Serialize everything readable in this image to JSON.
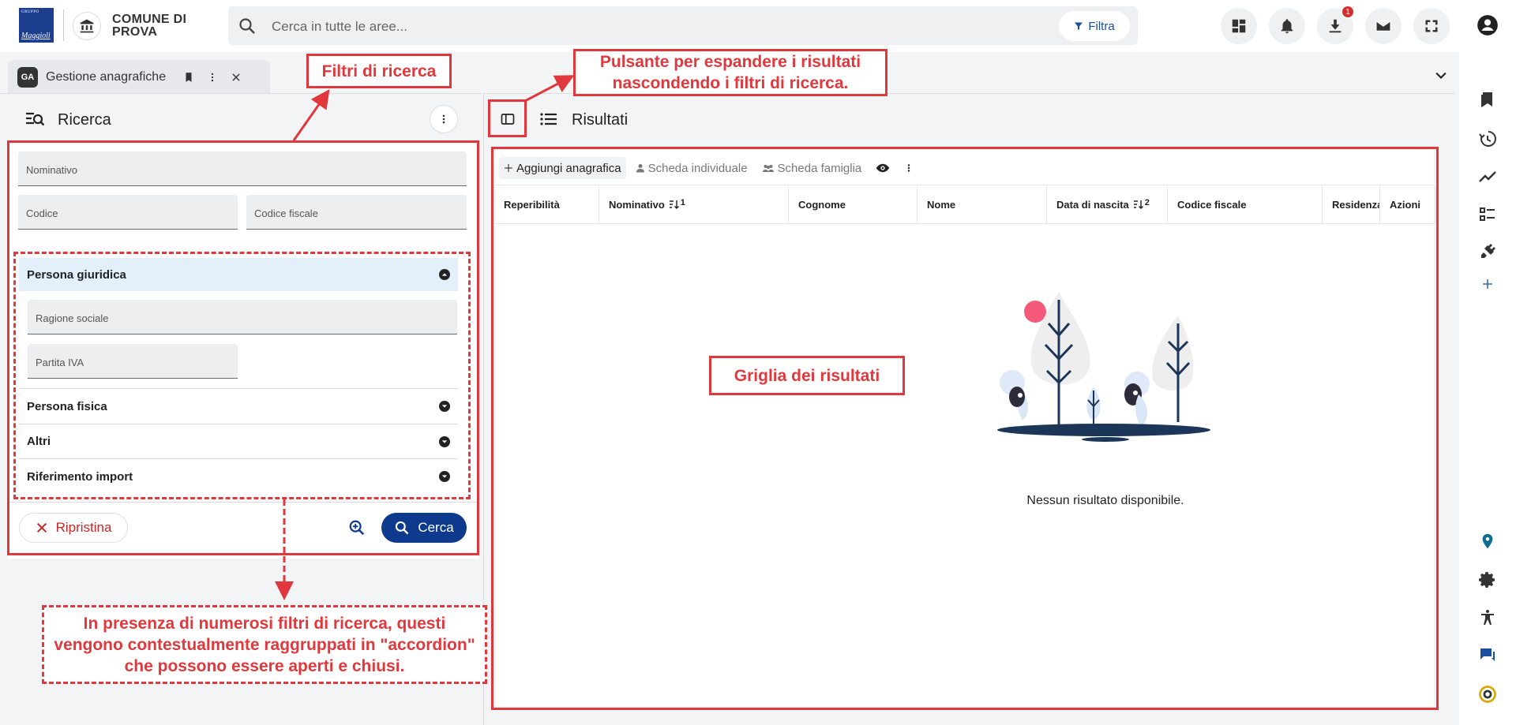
{
  "header": {
    "logo_group": "GRUPPO",
    "logo_brand": "Maggioli",
    "comune_name": "COMUNE DI PROVA",
    "search_placeholder": "Cerca in tutte le aree...",
    "filter_label": "Filtra",
    "download_badge": "1"
  },
  "tab": {
    "app_badge": "GA",
    "title": "Gestione anagrafiche"
  },
  "search_panel": {
    "title": "Ricerca",
    "fields": {
      "nominativo": "Nominativo",
      "codice": "Codice",
      "codice_fiscale": "Codice fiscale",
      "ragione_sociale": "Ragione sociale",
      "partita_iva": "Partita IVA"
    },
    "accordions": [
      {
        "label": "Persona giuridica",
        "expanded": true
      },
      {
        "label": "Persona fisica",
        "expanded": false
      },
      {
        "label": "Altri",
        "expanded": false
      },
      {
        "label": "Riferimento import",
        "expanded": false
      }
    ],
    "reset_label": "Ripristina",
    "search_label": "Cerca"
  },
  "results_panel": {
    "title": "Risultati",
    "toolbar": {
      "add": "Aggiungi anagrafica",
      "individual": "Scheda individuale",
      "family": "Scheda famiglia"
    },
    "columns": [
      {
        "label": "Reperibilità",
        "sort": ""
      },
      {
        "label": "Nominativo",
        "sort": "1"
      },
      {
        "label": "Cognome",
        "sort": ""
      },
      {
        "label": "Nome",
        "sort": ""
      },
      {
        "label": "Data di nascita",
        "sort": "2"
      },
      {
        "label": "Codice fiscale",
        "sort": ""
      },
      {
        "label": "Residenza",
        "sort": ""
      },
      {
        "label": "Azioni",
        "sort": ""
      }
    ],
    "empty_message": "Nessun risultato disponibile."
  },
  "annotations": {
    "filtri": "Filtri di ricerca",
    "pulsante": "Pulsante per espandere i risultati nascondendo i filtri di ricerca.",
    "griglia": "Griglia dei risultati",
    "accordion": "In presenza di numerosi filtri di ricerca, questi vengono contestualmente raggruppati in \"accordion\" che possono essere aperti e chiusi."
  },
  "colors": {
    "primary": "#0d3a8c",
    "annotation": "#e0383c",
    "accent_blue": "#1a4fa0",
    "accordion_open_bg": "#e3f0fb"
  }
}
